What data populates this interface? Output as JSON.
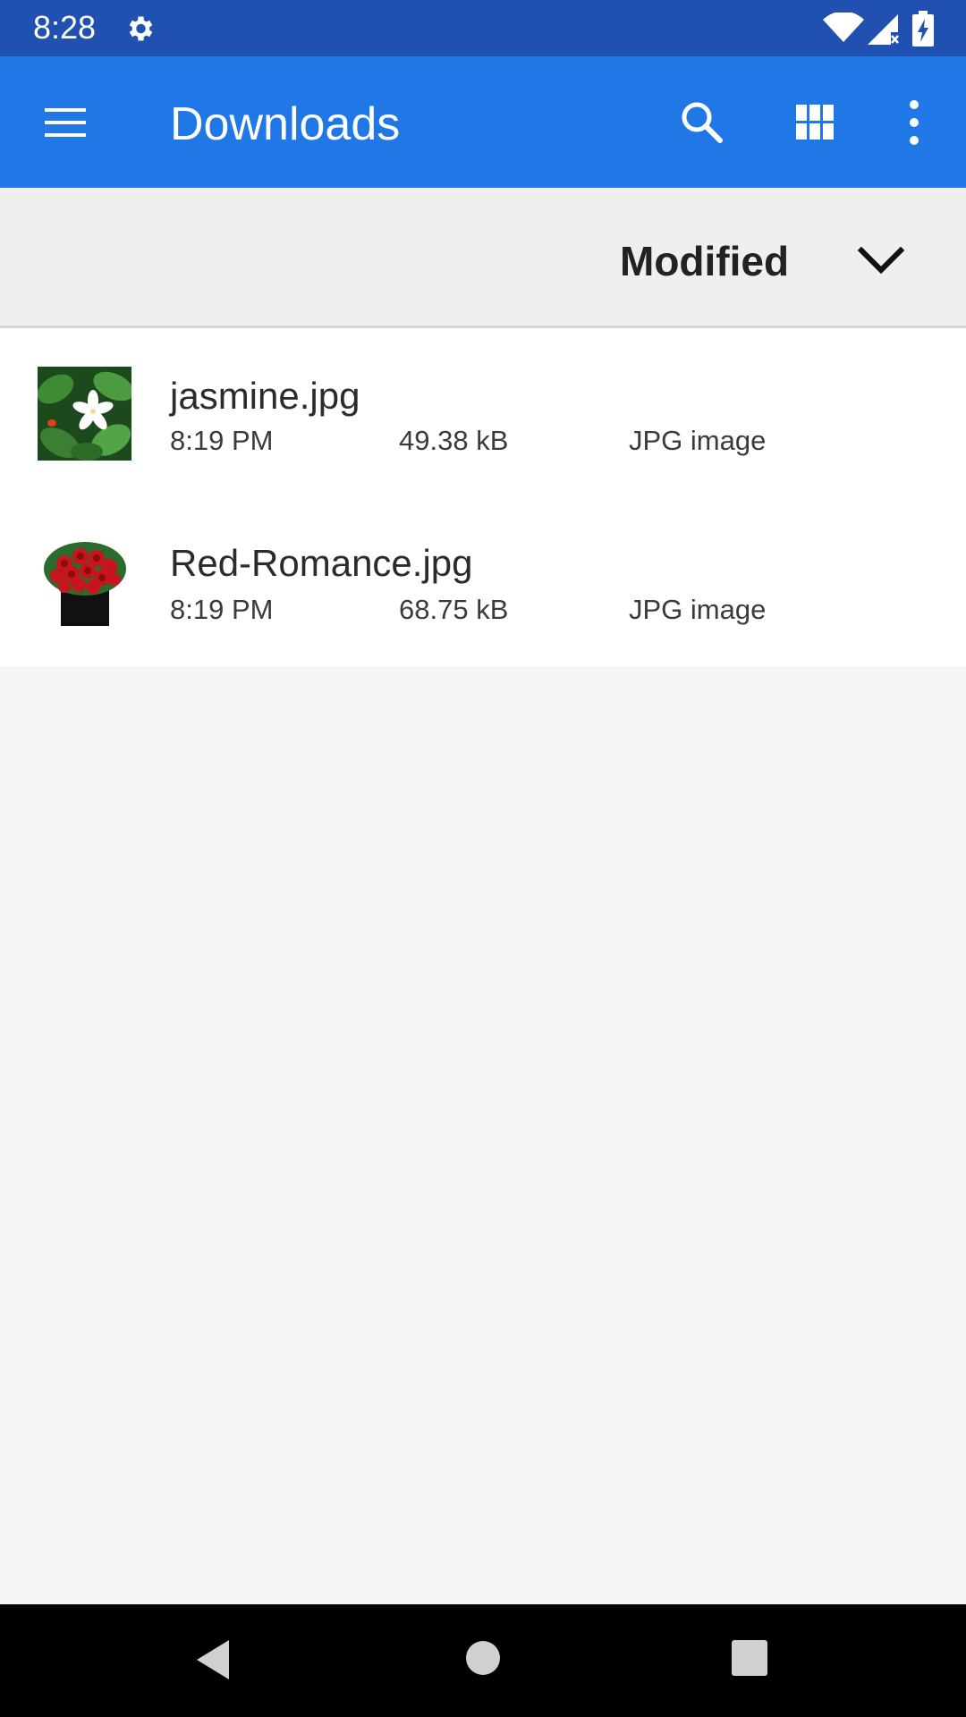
{
  "status_bar": {
    "time": "8:28",
    "icons": [
      "settings-gear-icon",
      "wifi-icon",
      "cell-signal-icon",
      "battery-charging-icon"
    ]
  },
  "app_bar": {
    "title": "Downloads",
    "actions": [
      "menu-icon",
      "search-icon",
      "grid-view-icon",
      "more-vert-icon"
    ],
    "color": "#1f78e6"
  },
  "sort": {
    "label": "Modified",
    "icon": "chevron-down-icon"
  },
  "files": [
    {
      "name": "jasmine.jpg",
      "time": "8:19 PM",
      "size": "49.38 kB",
      "type": "JPG image",
      "thumbnail": "jasmine-flower-thumbnail"
    },
    {
      "name": "Red-Romance.jpg",
      "time": "8:19 PM",
      "size": "68.75 kB",
      "type": "JPG image",
      "thumbnail": "red-roses-bouquet-thumbnail"
    }
  ],
  "nav_bar": {
    "buttons": [
      "back-icon",
      "home-icon",
      "recents-icon"
    ]
  }
}
